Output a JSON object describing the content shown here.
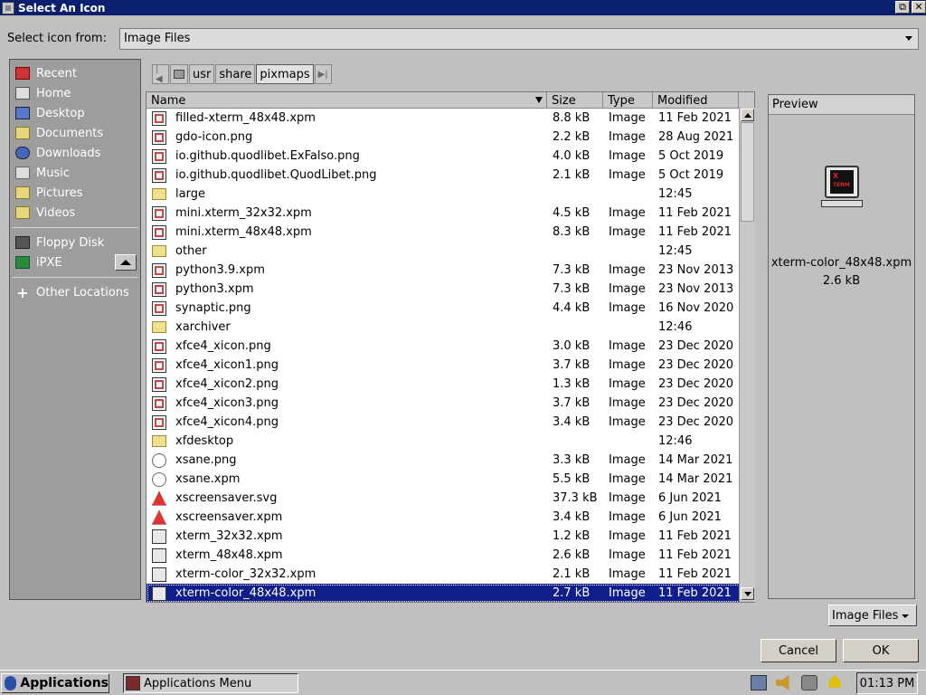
{
  "window": {
    "title": "Select An Icon",
    "buttons": [
      "⧉",
      "✕"
    ]
  },
  "source": {
    "label": "Select icon from:",
    "value": "Image Files"
  },
  "sidebar": {
    "places": [
      {
        "label": "Recent",
        "icon": "recent-icon"
      },
      {
        "label": "Home",
        "icon": "home-icon"
      },
      {
        "label": "Desktop",
        "icon": "desktop-icon"
      },
      {
        "label": "Documents",
        "icon": "folder-icon"
      },
      {
        "label": "Downloads",
        "icon": "downloads-icon"
      },
      {
        "label": "Music",
        "icon": "music-icon"
      },
      {
        "label": "Pictures",
        "icon": "folder-icon"
      },
      {
        "label": "Videos",
        "icon": "folder-icon"
      }
    ],
    "devices": [
      {
        "label": "Floppy Disk",
        "icon": "floppy-icon"
      },
      {
        "label": "iPXE",
        "icon": "network-drive-icon"
      }
    ],
    "other": {
      "label": "Other Locations",
      "icon": "plus-icon"
    }
  },
  "pathbar": {
    "segments": [
      "usr",
      "share",
      "pixmaps"
    ],
    "active": "pixmaps"
  },
  "filelist": {
    "columns": {
      "name": "Name",
      "size": "Size",
      "type": "Type",
      "modified": "Modified"
    },
    "files": [
      {
        "name": "filled-xterm_48x48.xpm",
        "size": "8.8 kB",
        "type": "Image",
        "modified": "11 Feb 2021",
        "icon": "image-file-icon"
      },
      {
        "name": "gdo-icon.png",
        "size": "2.2 kB",
        "type": "Image",
        "modified": "28 Aug 2021",
        "icon": "image-file-icon"
      },
      {
        "name": "io.github.quodlibet.ExFalso.png",
        "size": "4.0 kB",
        "type": "Image",
        "modified": "5 Oct 2019",
        "icon": "image-file-icon"
      },
      {
        "name": "io.github.quodlibet.QuodLibet.png",
        "size": "2.1 kB",
        "type": "Image",
        "modified": "5 Oct 2019",
        "icon": "image-file-icon"
      },
      {
        "name": "large",
        "size": "",
        "type": "",
        "modified": "12:45",
        "icon": "folder-icon"
      },
      {
        "name": "mini.xterm_32x32.xpm",
        "size": "4.5 kB",
        "type": "Image",
        "modified": "11 Feb 2021",
        "icon": "image-file-icon"
      },
      {
        "name": "mini.xterm_48x48.xpm",
        "size": "8.3 kB",
        "type": "Image",
        "modified": "11 Feb 2021",
        "icon": "image-file-icon"
      },
      {
        "name": "other",
        "size": "",
        "type": "",
        "modified": "12:45",
        "icon": "folder-icon"
      },
      {
        "name": "python3.9.xpm",
        "size": "7.3 kB",
        "type": "Image",
        "modified": "23 Nov 2013",
        "icon": "image-file-icon"
      },
      {
        "name": "python3.xpm",
        "size": "7.3 kB",
        "type": "Image",
        "modified": "23 Nov 2013",
        "icon": "image-file-icon"
      },
      {
        "name": "synaptic.png",
        "size": "4.4 kB",
        "type": "Image",
        "modified": "16 Nov 2020",
        "icon": "image-file-icon"
      },
      {
        "name": "xarchiver",
        "size": "",
        "type": "",
        "modified": "12:46",
        "icon": "folder-icon"
      },
      {
        "name": "xfce4_xicon.png",
        "size": "3.0 kB",
        "type": "Image",
        "modified": "23 Dec 2020",
        "icon": "image-file-icon"
      },
      {
        "name": "xfce4_xicon1.png",
        "size": "3.7 kB",
        "type": "Image",
        "modified": "23 Dec 2020",
        "icon": "image-file-icon"
      },
      {
        "name": "xfce4_xicon2.png",
        "size": "1.3 kB",
        "type": "Image",
        "modified": "23 Dec 2020",
        "icon": "image-file-icon"
      },
      {
        "name": "xfce4_xicon3.png",
        "size": "3.7 kB",
        "type": "Image",
        "modified": "23 Dec 2020",
        "icon": "image-file-icon"
      },
      {
        "name": "xfce4_xicon4.png",
        "size": "3.4 kB",
        "type": "Image",
        "modified": "23 Dec 2020",
        "icon": "image-file-icon"
      },
      {
        "name": "xfdesktop",
        "size": "",
        "type": "",
        "modified": "12:46",
        "icon": "folder-icon"
      },
      {
        "name": "xsane.png",
        "size": "3.3 kB",
        "type": "Image",
        "modified": "14 Mar 2021",
        "icon": "xsane-icon"
      },
      {
        "name": "xsane.xpm",
        "size": "5.5 kB",
        "type": "Image",
        "modified": "14 Mar 2021",
        "icon": "xsane-icon"
      },
      {
        "name": "xscreensaver.svg",
        "size": "37.3 kB",
        "type": "Image",
        "modified": "6 Jun 2021",
        "icon": "screensaver-icon"
      },
      {
        "name": "xscreensaver.xpm",
        "size": "3.4 kB",
        "type": "Image",
        "modified": "6 Jun 2021",
        "icon": "screensaver-icon"
      },
      {
        "name": "xterm_32x32.xpm",
        "size": "1.2 kB",
        "type": "Image",
        "modified": "11 Feb 2021",
        "icon": "terminal-icon"
      },
      {
        "name": "xterm_48x48.xpm",
        "size": "2.6 kB",
        "type": "Image",
        "modified": "11 Feb 2021",
        "icon": "terminal-icon"
      },
      {
        "name": "xterm-color_32x32.xpm",
        "size": "2.1 kB",
        "type": "Image",
        "modified": "11 Feb 2021",
        "icon": "terminal-icon"
      },
      {
        "name": "xterm-color_48x48.xpm",
        "size": "2.7 kB",
        "type": "Image",
        "modified": "11 Feb 2021",
        "icon": "terminal-icon",
        "selected": true
      }
    ]
  },
  "preview": {
    "header": "Preview",
    "image_text_top": "X",
    "image_text_bottom": "TERM",
    "filename": "xterm-color_48x48.xpm",
    "size": "2.6 kB"
  },
  "filter": {
    "value": "Image Files"
  },
  "buttons": {
    "cancel": "Cancel",
    "ok": "OK"
  },
  "taskbar": {
    "applications": "Applications",
    "window_label": "Applications Menu",
    "clock": "01:13 PM"
  },
  "colors": {
    "titlebar": "#0a1f6e",
    "selection": "#0f1e8a",
    "sidebar": "#9d9d9d"
  }
}
